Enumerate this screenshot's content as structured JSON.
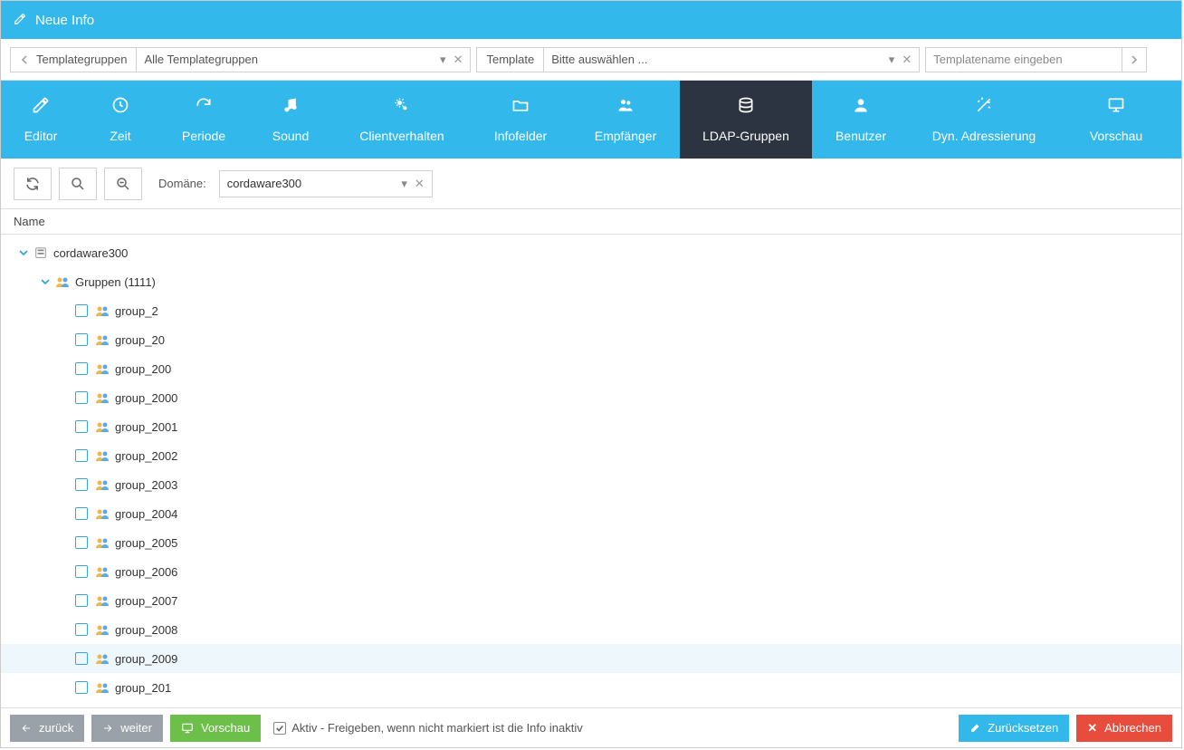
{
  "title": "Neue Info",
  "filter": {
    "templategroups_label": "Templategruppen",
    "templategroups_value": "Alle Templategruppen",
    "template_label": "Template",
    "template_value": "Bitte auswählen ...",
    "templatename_placeholder": "Templatename eingeben"
  },
  "tabs": [
    {
      "key": "editor",
      "label": "Editor"
    },
    {
      "key": "zeit",
      "label": "Zeit"
    },
    {
      "key": "periode",
      "label": "Periode"
    },
    {
      "key": "sound",
      "label": "Sound"
    },
    {
      "key": "client",
      "label": "Clientverhalten"
    },
    {
      "key": "info",
      "label": "Infofelder"
    },
    {
      "key": "emp",
      "label": "Empfänger"
    },
    {
      "key": "ldap",
      "label": "LDAP-Gruppen"
    },
    {
      "key": "ben",
      "label": "Benutzer"
    },
    {
      "key": "dyn",
      "label": "Dyn. Adressierung"
    },
    {
      "key": "vor",
      "label": "Vorschau"
    }
  ],
  "active_tab": "ldap",
  "toolbar": {
    "domain_label": "Domäne:",
    "domain_value": "cordaware300"
  },
  "column_header": "Name",
  "tree": {
    "root": "cordaware300",
    "groups_label": "Gruppen (1111)",
    "items": [
      "group_2",
      "group_20",
      "group_200",
      "group_2000",
      "group_2001",
      "group_2002",
      "group_2003",
      "group_2004",
      "group_2005",
      "group_2006",
      "group_2007",
      "group_2008",
      "group_2009",
      "group_201"
    ],
    "hover_index": 12
  },
  "footer": {
    "back": "zurück",
    "next": "weiter",
    "preview": "Vorschau",
    "active_label": "Aktiv - Freigeben, wenn nicht markiert ist die Info inaktiv",
    "reset": "Zurücksetzen",
    "cancel": "Abbrechen"
  }
}
